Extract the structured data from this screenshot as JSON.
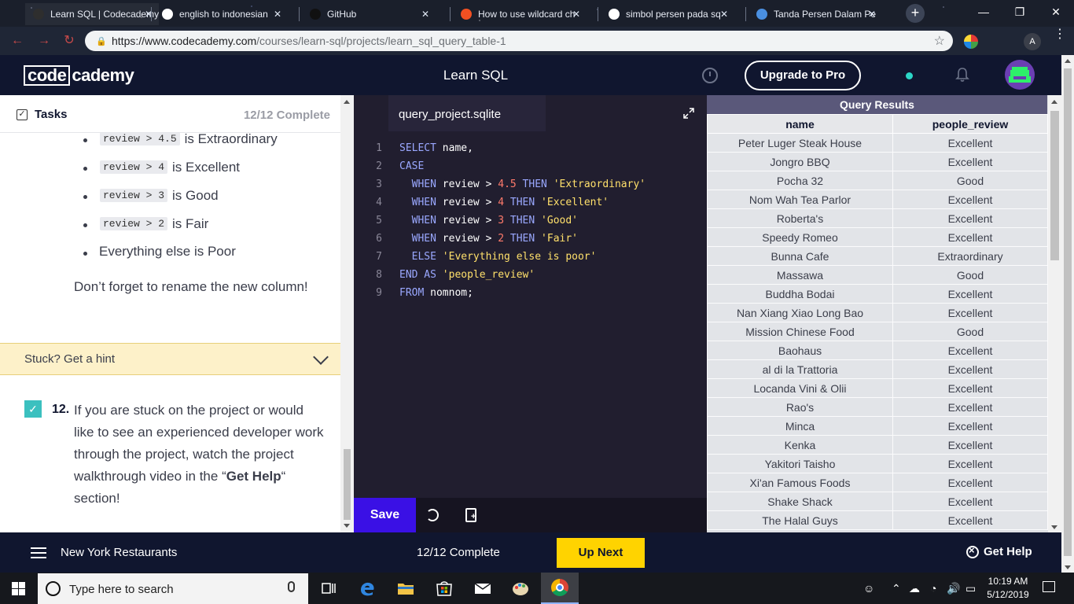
{
  "browser": {
    "tabs": [
      {
        "title": "Learn SQL | Codecademy",
        "icon": "codecademy-icon",
        "active": true
      },
      {
        "title": "english to indonesian",
        "icon": "google-icon"
      },
      {
        "title": "GitHub",
        "icon": "github-icon"
      },
      {
        "title": "How to use wildcard ch",
        "icon": "microsoft-icon"
      },
      {
        "title": "simbol persen pada sq",
        "icon": "google-icon"
      },
      {
        "title": "Tanda Persen Dalam Pe",
        "icon": "site-icon"
      }
    ],
    "url_host": "https://www.codecademy.com",
    "url_path": "/courses/learn-sql/projects/learn_sql_query_table-1",
    "profile_initial": "A"
  },
  "header": {
    "logo_boxed": "code",
    "logo_rest": "cademy",
    "title": "Learn SQL",
    "upgrade_label": "Upgrade to Pro"
  },
  "tasks": {
    "label": "Tasks",
    "progress": "12/12 Complete",
    "bullets": [
      {
        "code": "review > 4.5",
        "text": "is Extraordinary"
      },
      {
        "code": "review > 4",
        "text": "is Excellent"
      },
      {
        "code": "review > 3",
        "text": "is Good"
      },
      {
        "code": "review > 2",
        "text": "is Fair"
      },
      {
        "code": "",
        "text": "Everything else is Poor"
      }
    ],
    "reminder": "Don’t forget to rename the new column!",
    "hint_label": "Stuck? Get a hint",
    "task12": {
      "number": "12.",
      "text_before": "If you are stuck on the project or would like to see an experienced developer work through the project, watch the project walkthrough video in the “",
      "text_bold": "Get Help",
      "text_after": "“ section!"
    }
  },
  "editor": {
    "filename": "query_project.sqlite",
    "lines": [
      [
        {
          "t": "SELECT",
          "c": "kw"
        },
        {
          "t": " name,",
          "c": ""
        }
      ],
      [
        {
          "t": "CASE",
          "c": "kw"
        }
      ],
      [
        {
          "t": "  WHEN",
          "c": "kw"
        },
        {
          "t": " review > ",
          "c": ""
        },
        {
          "t": "4.5",
          "c": "num"
        },
        {
          "t": " THEN",
          "c": "kw"
        },
        {
          "t": " 'Extraordinary'",
          "c": "str"
        }
      ],
      [
        {
          "t": "  WHEN",
          "c": "kw"
        },
        {
          "t": " review > ",
          "c": ""
        },
        {
          "t": "4",
          "c": "num"
        },
        {
          "t": " THEN",
          "c": "kw"
        },
        {
          "t": " 'Excellent'",
          "c": "str"
        }
      ],
      [
        {
          "t": "  WHEN",
          "c": "kw"
        },
        {
          "t": " review > ",
          "c": ""
        },
        {
          "t": "3",
          "c": "num"
        },
        {
          "t": " THEN",
          "c": "kw"
        },
        {
          "t": " 'Good'",
          "c": "str"
        }
      ],
      [
        {
          "t": "  WHEN",
          "c": "kw"
        },
        {
          "t": " review > ",
          "c": ""
        },
        {
          "t": "2",
          "c": "num"
        },
        {
          "t": " THEN",
          "c": "kw"
        },
        {
          "t": " 'Fair'",
          "c": "str"
        }
      ],
      [
        {
          "t": "  ELSE",
          "c": "kw"
        },
        {
          "t": " 'Everything else is poor'",
          "c": "str"
        }
      ],
      [
        {
          "t": "END AS",
          "c": "kw"
        },
        {
          "t": " 'people_review'",
          "c": "str"
        }
      ],
      [
        {
          "t": "FROM",
          "c": "kw"
        },
        {
          "t": " nomnom;",
          "c": ""
        }
      ]
    ],
    "save_label": "Save"
  },
  "results": {
    "title": "Query Results",
    "columns": [
      "name",
      "people_review"
    ],
    "rows": [
      [
        "Peter Luger Steak House",
        "Excellent"
      ],
      [
        "Jongro BBQ",
        "Excellent"
      ],
      [
        "Pocha 32",
        "Good"
      ],
      [
        "Nom Wah Tea Parlor",
        "Excellent"
      ],
      [
        "Roberta's",
        "Excellent"
      ],
      [
        "Speedy Romeo",
        "Excellent"
      ],
      [
        "Bunna Cafe",
        "Extraordinary"
      ],
      [
        "Massawa",
        "Good"
      ],
      [
        "Buddha Bodai",
        "Excellent"
      ],
      [
        "Nan Xiang Xiao Long Bao",
        "Excellent"
      ],
      [
        "Mission Chinese Food",
        "Good"
      ],
      [
        "Baohaus",
        "Excellent"
      ],
      [
        "al di la Trattoria",
        "Excellent"
      ],
      [
        "Locanda Vini & Olii",
        "Excellent"
      ],
      [
        "Rao's",
        "Excellent"
      ],
      [
        "Minca",
        "Excellent"
      ],
      [
        "Kenka",
        "Excellent"
      ],
      [
        "Yakitori Taisho",
        "Excellent"
      ],
      [
        "Xi'an Famous Foods",
        "Excellent"
      ],
      [
        "Shake Shack",
        "Excellent"
      ],
      [
        "The Halal Guys",
        "Excellent"
      ]
    ]
  },
  "footer": {
    "project": "New York Restaurants",
    "progress": "12/12 Complete",
    "up_next": "Up Next",
    "get_help": "Get Help"
  },
  "taskbar": {
    "search_placeholder": "Type here to search",
    "time": "10:19 AM",
    "date": "5/12/2019"
  },
  "colors": {
    "accent": "#3a10e5",
    "up_next": "#ffd300",
    "header_bg": "#10162f",
    "editor_bg": "#211e2f",
    "results_header": "#5a587a"
  }
}
